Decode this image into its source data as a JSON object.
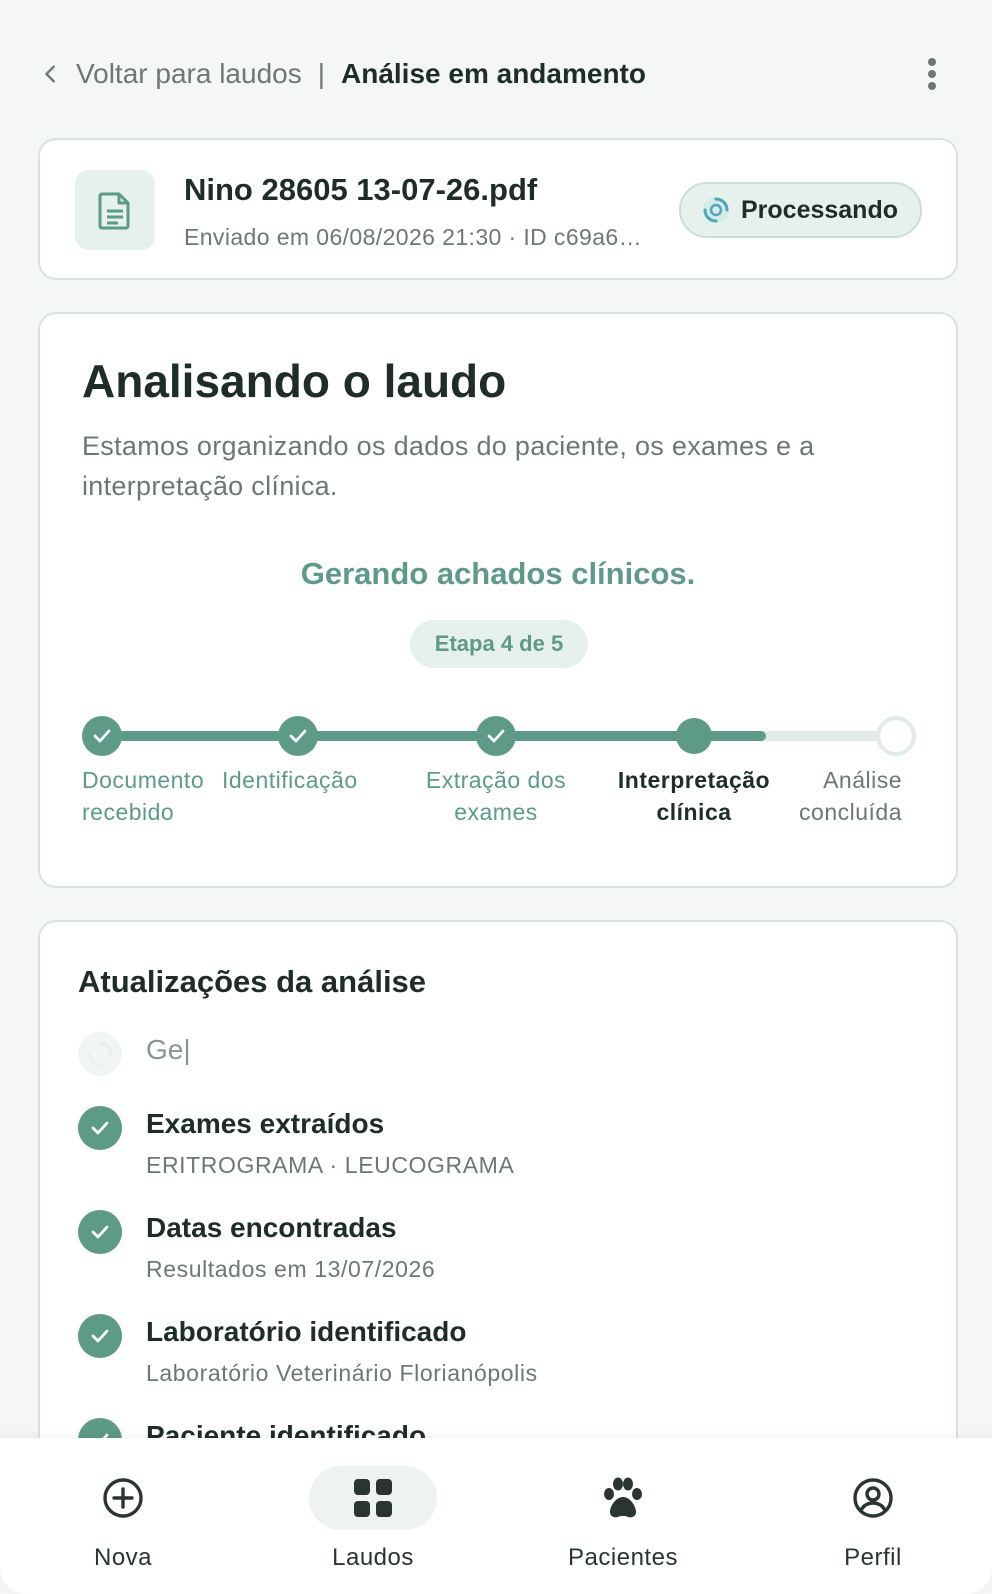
{
  "header": {
    "back_label": "Voltar para laudos",
    "separator": "|",
    "title": "Análise em andamento"
  },
  "file": {
    "name": "Nino 28605 13-07-26.pdf",
    "meta": "Enviado em 06/08/2026 21:30 · ID c69a6…",
    "status": "Processando"
  },
  "analysis": {
    "title": "Analisando o laudo",
    "description": "Estamos organizando os dados do paciente, os exames e a interpretação clínica.",
    "current_step_text": "Gerando achados clínicos.",
    "step_badge": "Etapa 4 de 5",
    "progress_fraction": 0.83,
    "steps": [
      {
        "label_line1": "Documento",
        "label_line2": "recebido",
        "state": "done"
      },
      {
        "label_line1": "Identificação",
        "label_line2": "",
        "state": "done"
      },
      {
        "label_line1": "Extração dos",
        "label_line2": "exames",
        "state": "done"
      },
      {
        "label_line1": "Interpretação",
        "label_line2": "clínica",
        "state": "active"
      },
      {
        "label_line1": "Análise",
        "label_line2": "concluída",
        "state": "todo"
      }
    ]
  },
  "updates": {
    "title": "Atualizações da análise",
    "typing_text": "Ge|",
    "items": [
      {
        "title": "Exames extraídos",
        "detail": "ERITROGRAMA · LEUCOGRAMA"
      },
      {
        "title": "Datas encontradas",
        "detail": "Resultados em 13/07/2026"
      },
      {
        "title": "Laboratório identificado",
        "detail": "Laboratório Veterinário Florianópolis"
      },
      {
        "title": "Paciente identificado",
        "detail": ""
      }
    ]
  },
  "nav": {
    "items": [
      {
        "label": "Nova",
        "icon": "plus-circle-icon"
      },
      {
        "label": "Laudos",
        "icon": "grid-icon",
        "active": true
      },
      {
        "label": "Pacientes",
        "icon": "paw-icon"
      },
      {
        "label": "Perfil",
        "icon": "user-circle-icon"
      }
    ]
  },
  "colors": {
    "accent": "#5e9a88",
    "text": "#1f2d2a",
    "muted": "#6b7875",
    "background": "#f4f7f6"
  }
}
